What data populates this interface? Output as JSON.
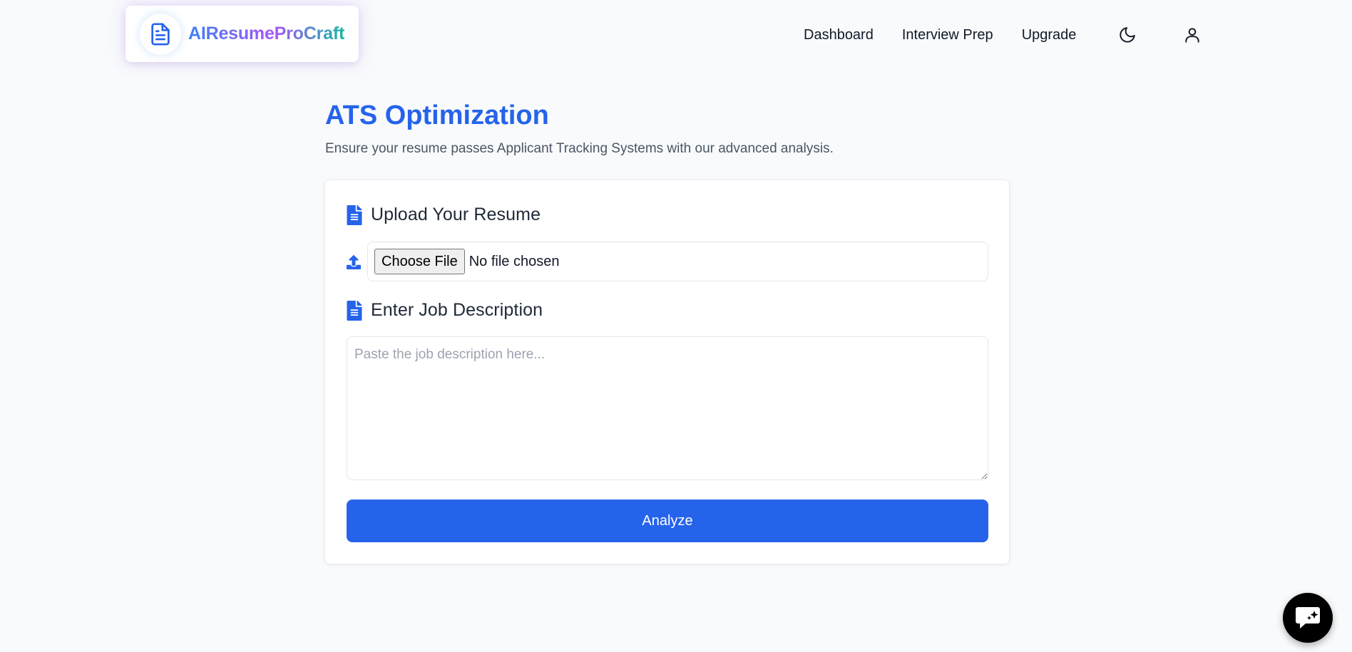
{
  "brand": {
    "name": "AIResumeProCraft",
    "logo_icon": "document-icon",
    "gradient": [
      "#3b82f6",
      "#a855f7",
      "#14b8a6"
    ]
  },
  "nav": {
    "items": [
      {
        "label": "Dashboard"
      },
      {
        "label": "Interview Prep"
      },
      {
        "label": "Upgrade"
      }
    ],
    "theme_icon": "moon-icon",
    "account_icon": "user-icon"
  },
  "page": {
    "title": "ATS Optimization",
    "subtitle": "Ensure your resume passes Applicant Tracking Systems with our advanced analysis."
  },
  "upload": {
    "heading": "Upload Your Resume",
    "heading_icon": "file-text-icon",
    "row_icon": "upload-icon",
    "choose_label": "Choose File",
    "status": "No file chosen"
  },
  "job_description": {
    "heading": "Enter Job Description",
    "heading_icon": "file-text-icon",
    "placeholder": "Paste the job description here...",
    "value": ""
  },
  "actions": {
    "analyze_label": "Analyze"
  },
  "chat": {
    "icon": "chat-sparkle-icon"
  },
  "colors": {
    "primary": "#2563eb",
    "background": "#f8fafc",
    "text": "#111827",
    "muted": "#4b5563"
  }
}
